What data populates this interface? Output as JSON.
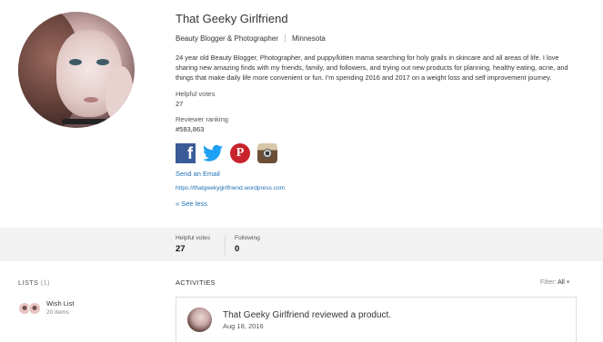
{
  "profile": {
    "name": "That Geeky Girlfriend",
    "occupation": "Beauty Blogger & Photographer",
    "location": "Minnesota",
    "bio": "24 year old Beauty Blogger, Photographer, and puppy/kitten mama searching for holy grails in skincare and all areas of life. I love sharing new amazing finds with my friends, family, and followers, and trying out new products for planning, healthy eating, acne, and things that make daily life more convenient or fun. I'm spending 2016 and 2017 on a weight loss and self improvement journey.",
    "helpful_votes_label": "Helpful votes",
    "helpful_votes_value": "27",
    "reviewer_ranking_label": "Reviewer ranking",
    "reviewer_ranking_value": "#583,863",
    "socials": {
      "facebook_icon": "facebook-icon",
      "twitter_icon": "twitter-icon",
      "pinterest_icon": "pinterest-icon",
      "instagram_icon": "instagram-icon",
      "facebook_glyph": "f",
      "pinterest_glyph": "P"
    },
    "send_email_label": "Send an Email",
    "website": "https://thatgeekygirlfriend.wordpress.com",
    "see_less_label": "« See less",
    "link_color": "#1f6fb2"
  },
  "stats_band": {
    "helpful_votes_label": "Helpful votes",
    "helpful_votes_value": "27",
    "following_label": "Following",
    "following_value": "0"
  },
  "lists": {
    "heading": "LISTS",
    "count": "(1)",
    "items": [
      {
        "name": "Wish List",
        "count": "20 items"
      }
    ]
  },
  "activities": {
    "heading": "ACTIVITIES",
    "filter_label": "Filter:",
    "filter_value": "All",
    "filter_caret": "▾",
    "items": [
      {
        "title": "That Geeky Girlfriend reviewed a product.",
        "date": "Aug 18, 2016"
      }
    ]
  }
}
